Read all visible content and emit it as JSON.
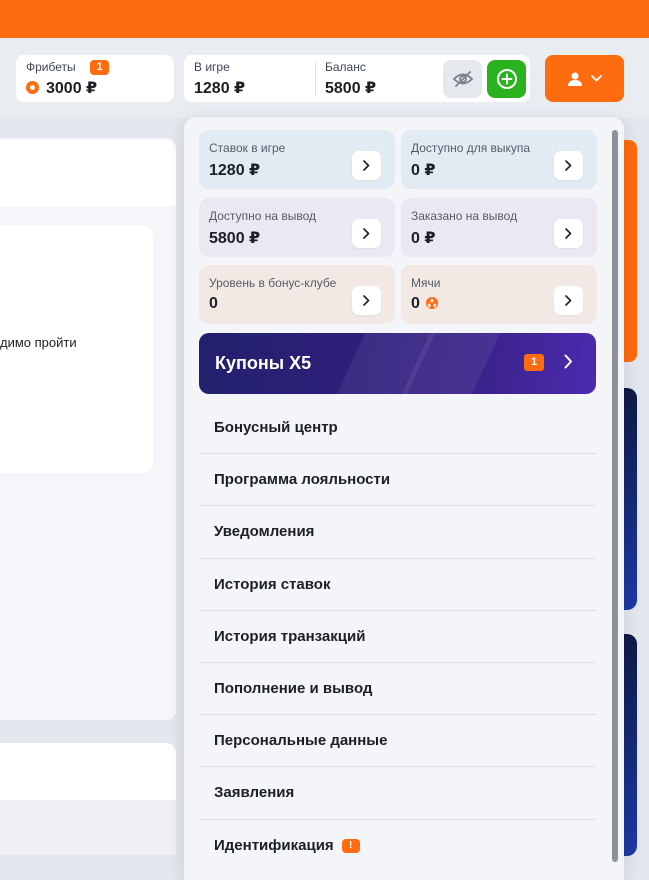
{
  "header": {
    "freebets": {
      "label": "Фрибеты",
      "badge": "1",
      "value": "3000 ₽"
    },
    "in_game": {
      "label": "В игре",
      "value": "1280 ₽"
    },
    "balance": {
      "label": "Баланс",
      "value": "5800 ₽"
    }
  },
  "background": {
    "partial_text": "димо пройти"
  },
  "account_menu": {
    "stats": [
      {
        "label": "Ставок в игре",
        "value": "1280 ₽"
      },
      {
        "label": "Доступно для выкупа",
        "value": "0 ₽"
      },
      {
        "label": "Доступно на вывод",
        "value": "5800 ₽"
      },
      {
        "label": "Заказано на вывод",
        "value": "0 ₽"
      },
      {
        "label": "Уровень в бонус-клубе",
        "value": "0"
      },
      {
        "label": "Мячи",
        "value": "0"
      }
    ],
    "coupons": {
      "label": "Купоны X5",
      "badge": "1"
    },
    "items": [
      {
        "label": "Бонусный центр"
      },
      {
        "label": "Программа лояльности"
      },
      {
        "label": "Уведомления"
      },
      {
        "label": "История ставок"
      },
      {
        "label": "История транзакций"
      },
      {
        "label": "Пополнение и вывод"
      },
      {
        "label": "Персональные данные"
      },
      {
        "label": "Заявления"
      },
      {
        "label": "Идентификация",
        "badge": "!"
      }
    ]
  },
  "colors": {
    "brand_orange": "#ff6b0f",
    "deposit_green": "#2bb31f",
    "coupons_purple": "#2e1f7a"
  },
  "icons": [
    "eye-off-icon",
    "plus-circle-icon",
    "user-icon",
    "chevron-down-icon",
    "chevron-right-icon",
    "ball-icon",
    "chip-icon"
  ]
}
